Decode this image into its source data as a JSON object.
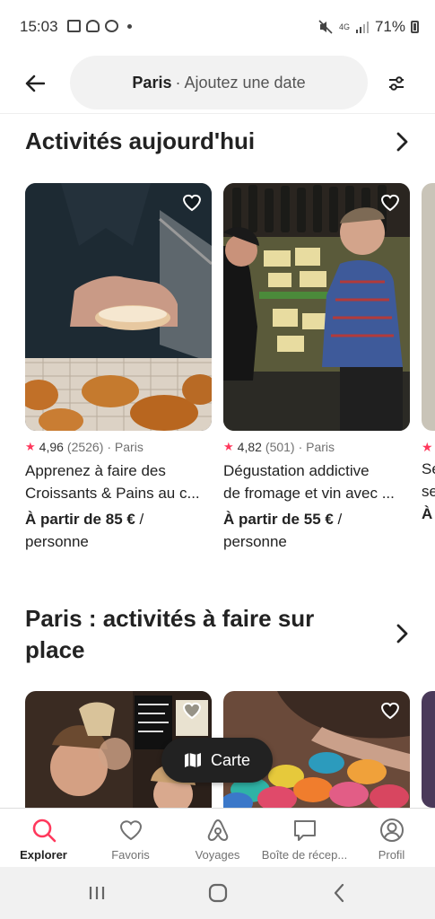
{
  "status": {
    "time": "15:03",
    "network": "4G",
    "battery": "71%"
  },
  "search": {
    "city": "Paris",
    "rest": "· Ajoutez une date"
  },
  "sections": [
    {
      "title": "Activités aujourd'hui"
    },
    {
      "title_line1": "Paris : activités à faire sur",
      "title_line2": "place"
    }
  ],
  "cards": [
    {
      "rating": "4,96",
      "count": "(2526)",
      "location": "· Paris",
      "title_line1": "Apprenez à faire des",
      "title_line2": "Croissants & Pains au c...",
      "price": "À partir de 85 €",
      "unit_tail": " /",
      "unit": "personne"
    },
    {
      "rating": "4,82",
      "count": "(501)",
      "location": "· Paris",
      "title_line1": "Dégustation addictive",
      "title_line2": "de fromage et vin avec ...",
      "price": "À partir de 55 €",
      "unit_tail": " /",
      "unit": "personne"
    }
  ],
  "peek": {
    "line1": "Se",
    "line2": "se",
    "line3": "À"
  },
  "map_button": "Carte",
  "tabs": [
    {
      "label": "Explorer",
      "icon": "search-icon",
      "active": true
    },
    {
      "label": "Favoris",
      "icon": "heart-icon"
    },
    {
      "label": "Voyages",
      "icon": "airbnb-logo-icon"
    },
    {
      "label": "Boîte de récep...",
      "icon": "message-icon"
    },
    {
      "label": "Profil",
      "icon": "profile-icon"
    }
  ],
  "colors": {
    "accent": "#ff385c",
    "text": "#222222"
  }
}
